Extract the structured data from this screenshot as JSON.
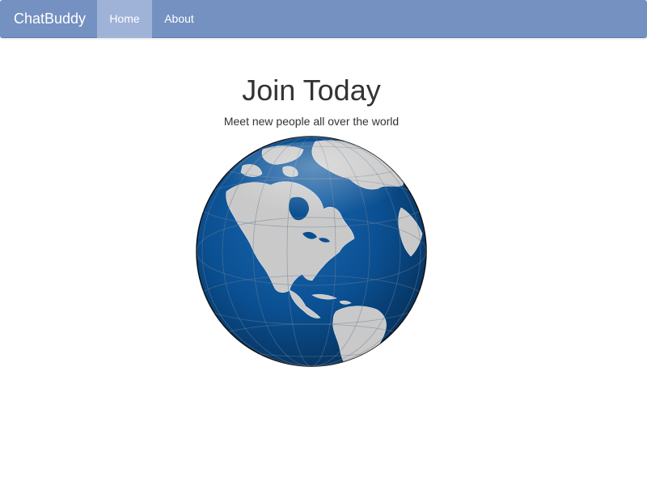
{
  "navbar": {
    "brand": "ChatBuddy",
    "items": [
      {
        "label": "Home",
        "active": true
      },
      {
        "label": "About",
        "active": false
      }
    ],
    "colors": {
      "bar": "#7491c1",
      "active": "#9fb2d7"
    }
  },
  "hero": {
    "title": "Join Today",
    "subtitle": "Meet new people all over the world"
  },
  "image": {
    "icon": "globe-icon",
    "colors": {
      "ocean": "#0a4e8f",
      "land": "#c9c9c9"
    }
  }
}
